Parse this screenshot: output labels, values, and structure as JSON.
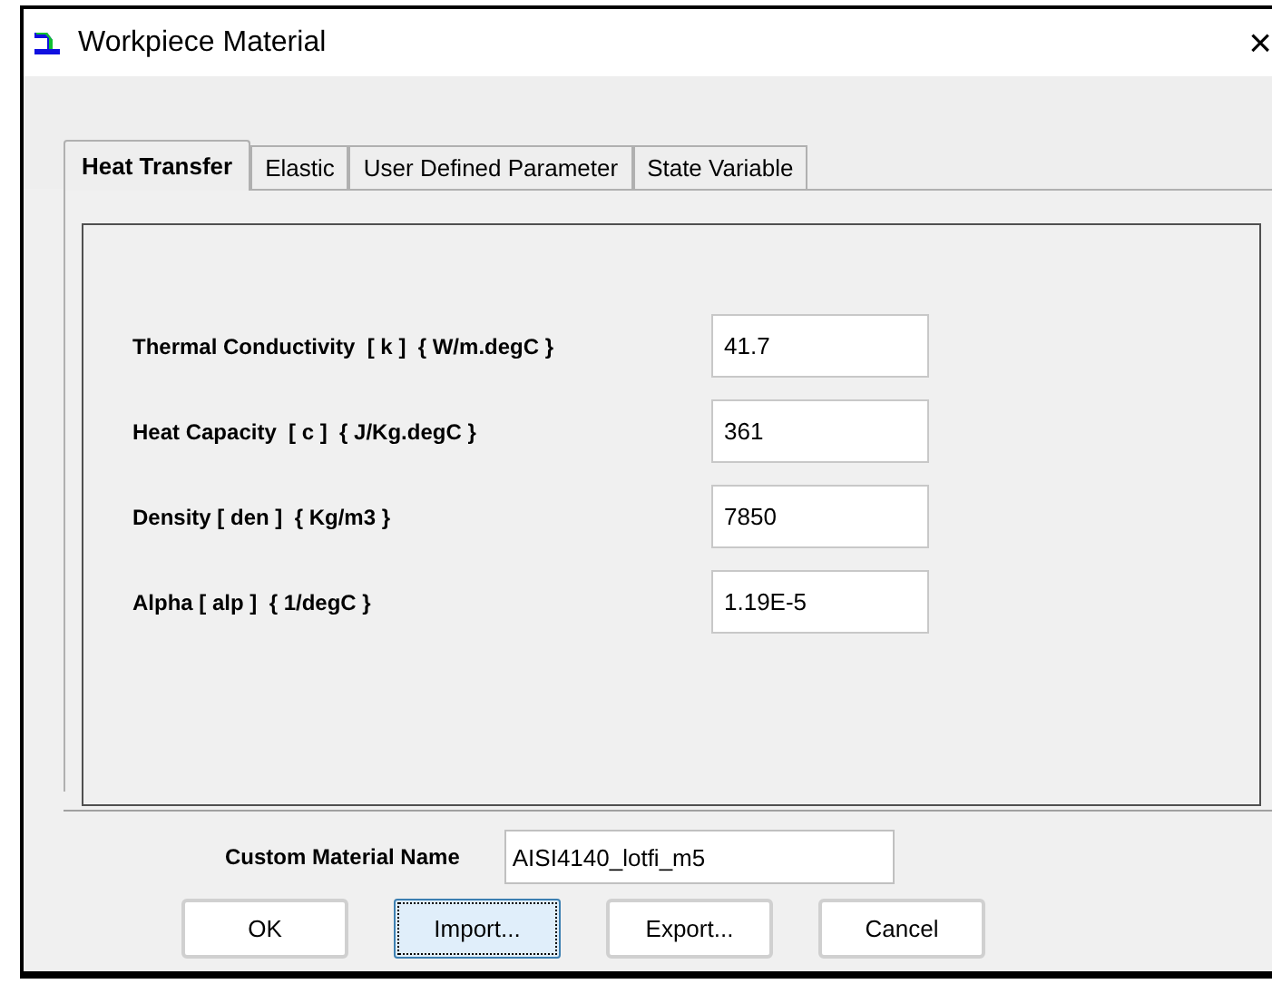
{
  "window": {
    "title": "Workpiece Material",
    "close": "×"
  },
  "tabs": [
    {
      "label": "Heat Transfer",
      "selected": true
    },
    {
      "label": "Elastic",
      "selected": false
    },
    {
      "label": "User Defined Parameter",
      "selected": false
    },
    {
      "label": "State Variable",
      "selected": false
    }
  ],
  "fields": [
    {
      "label": "Thermal Conductivity  [ k ]  { W/m.degC }",
      "value": "41.7"
    },
    {
      "label": "Heat Capacity  [ c ]  { J/Kg.degC }",
      "value": "361"
    },
    {
      "label": "Density [ den ]  { Kg/m3 }",
      "value": "7850"
    },
    {
      "label": "Alpha [ alp ]  { 1/degC }",
      "value": "1.19E-5"
    }
  ],
  "custom_name": {
    "label": "Custom Material Name",
    "value": "AISI4140_lotfi_m5"
  },
  "buttons": [
    {
      "label": "OK",
      "focused": false
    },
    {
      "label": "Import...",
      "focused": true
    },
    {
      "label": "Export...",
      "focused": false
    },
    {
      "label": "Cancel",
      "focused": false
    }
  ]
}
